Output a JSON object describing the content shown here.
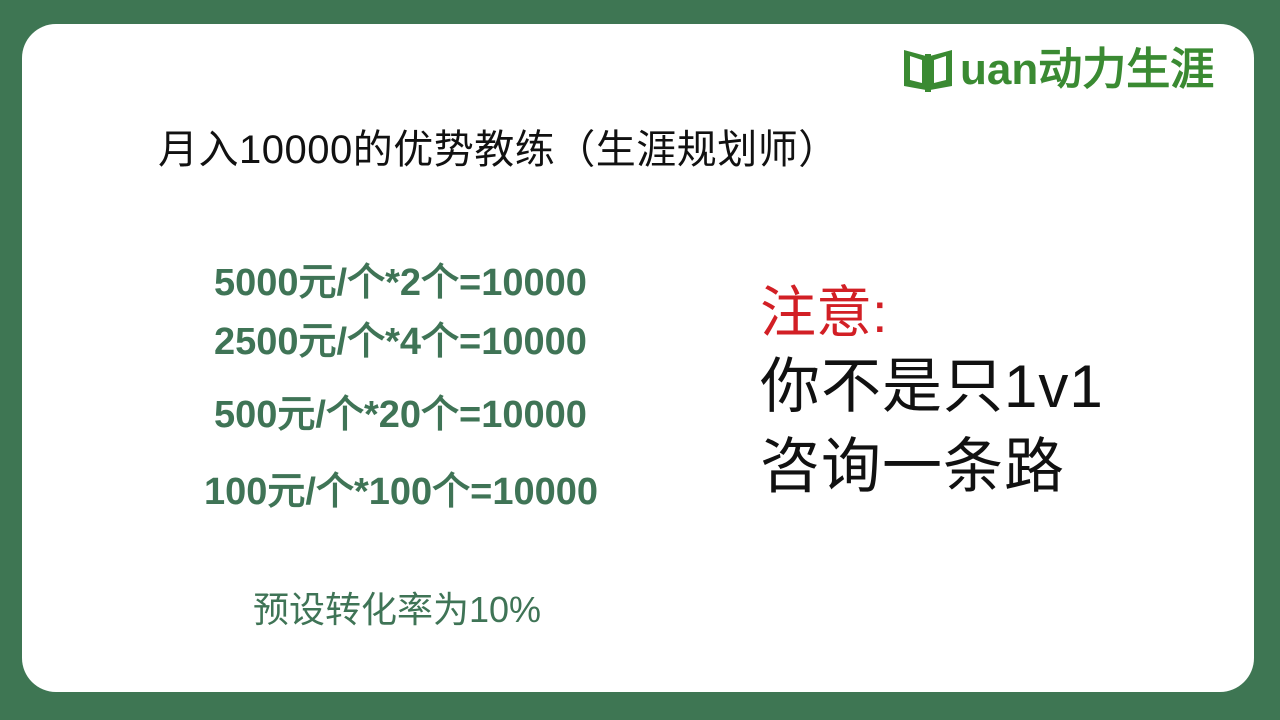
{
  "logo": {
    "brand_text": "uan动力生涯",
    "brand_color": "#3a8a32"
  },
  "title": "月入10000的优势教练（生涯规划师）",
  "equations": [
    "5000元/个*2个=10000",
    "2500元/个*4个=10000",
    "500元/个*20个=10000",
    "100元/个*100个=10000"
  ],
  "conversion_rate": "预设转化率为10%",
  "note": {
    "heading": "注意:",
    "line1": "你不是只1v1",
    "line2": "咨询一条路"
  },
  "colors": {
    "background": "#3e7653",
    "equation_text": "#3f7456",
    "note_heading": "#d21f25"
  }
}
